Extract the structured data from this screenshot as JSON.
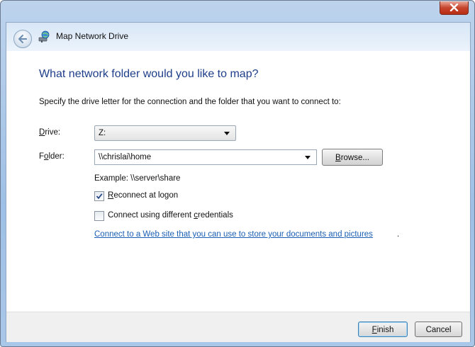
{
  "window": {
    "title": "Map Network Drive"
  },
  "main": {
    "heading": "What network folder would you like to map?",
    "instructions": "Specify the drive letter for the connection and the folder that you want to connect to:",
    "drive": {
      "label_accel": "D",
      "label_rest": "rive:",
      "value": "Z:"
    },
    "folder": {
      "label_pre": "F",
      "label_accel": "o",
      "label_rest": "lder:",
      "value": "\\\\chrislai\\home"
    },
    "browse_button": {
      "accel": "B",
      "rest": "rowse..."
    },
    "example_text": "Example: \\\\server\\share",
    "reconnect": {
      "accel": "R",
      "rest": "econnect at logon",
      "checked": true
    },
    "different_credentials": {
      "pre": "Connect using different ",
      "accel": "c",
      "rest": "redentials",
      "checked": false
    },
    "web_link": "Connect to a Web site that you can use to store your documents and pictures",
    "web_link_suffix": "."
  },
  "footer": {
    "finish": {
      "accel": "F",
      "rest": "inish"
    },
    "cancel": "Cancel"
  },
  "icons": [
    "close-icon",
    "back-arrow-icon",
    "network-drive-icon",
    "checkmark-icon",
    "dropdown-arrow-icon"
  ],
  "colors": {
    "heading": "#1e3e8a",
    "link": "#1a5fb4",
    "close_button": "#c7442c"
  }
}
